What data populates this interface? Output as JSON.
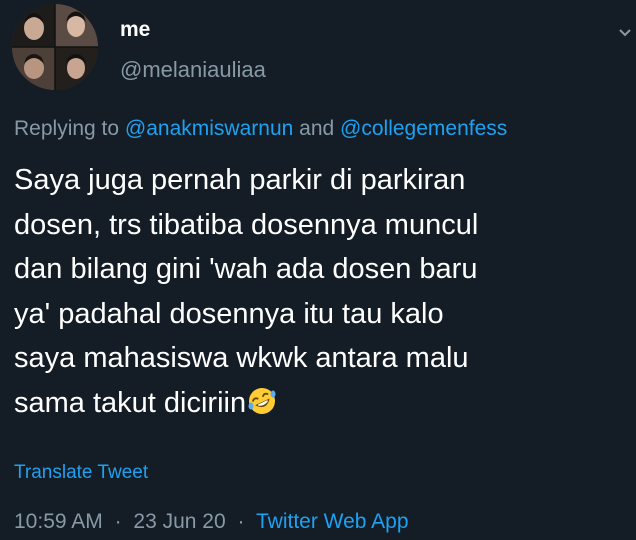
{
  "author": {
    "display_name": "me",
    "handle": "@melaniauliaa"
  },
  "reply_context": {
    "prefix": "Replying to",
    "mention_1": "@anakmiswarnun",
    "conjunction": "and",
    "mention_2": "@collegemenfess"
  },
  "tweet": {
    "text": "Saya juga pernah parkir di parkiran\ndosen, trs tibatiba dosennya muncul\ndan bilang gini 'wah ada dosen baru\nya' padahal dosennya itu tau kalo\nsaya mahasiswa wkwk antara malu\nsama takut diciriin",
    "emoji": "rolling-on-the-floor-laughing-emoji"
  },
  "translate_label": "Translate Tweet",
  "meta": {
    "time": "10:59 AM",
    "date": "23 Jun 20",
    "source": "Twitter Web App",
    "separator": "·"
  },
  "colors": {
    "background": "#141d26",
    "text": "#ffffff",
    "secondary": "#8899a6",
    "accent": "#1da1f2"
  }
}
